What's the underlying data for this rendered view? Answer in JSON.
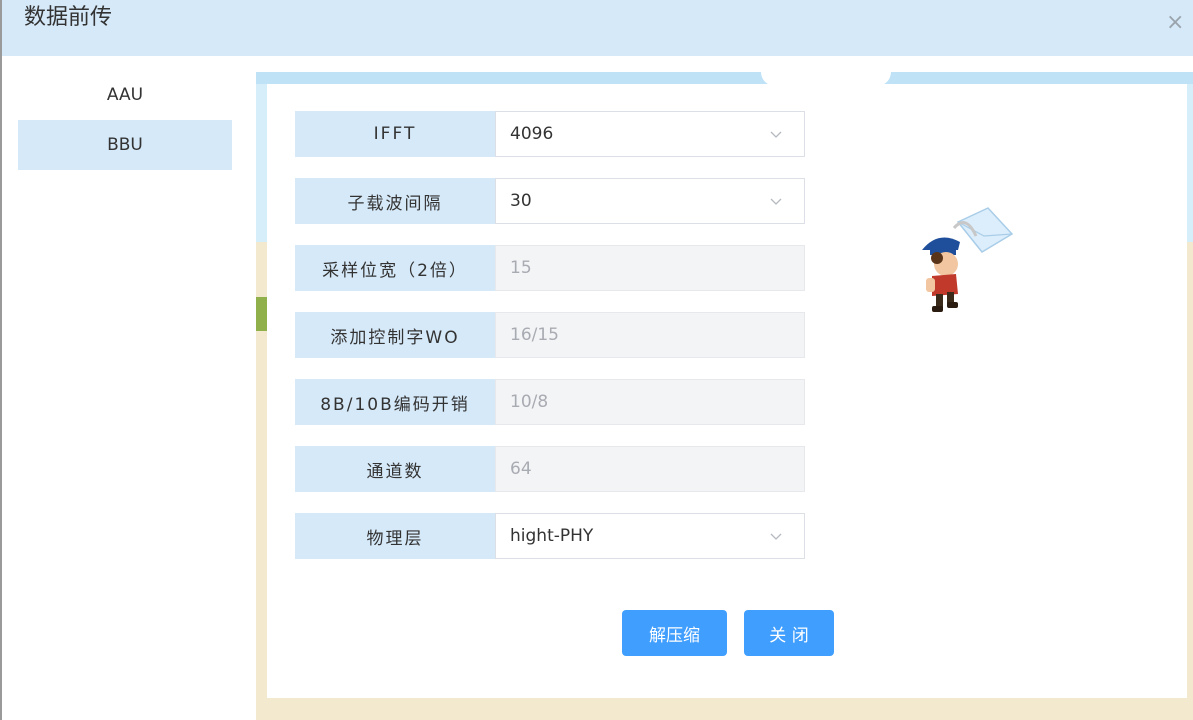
{
  "dialog": {
    "title": "数据前传",
    "close_label": "×"
  },
  "sidebar": {
    "items": [
      {
        "label": "AAU",
        "active": false
      },
      {
        "label": "BBU",
        "active": true
      }
    ]
  },
  "form": {
    "rows": [
      {
        "label": "IFFT",
        "value": "4096",
        "type": "select"
      },
      {
        "label": "子载波间隔",
        "value": "30",
        "type": "select"
      },
      {
        "label": "采样位宽（2倍）",
        "value": "15",
        "type": "readonly"
      },
      {
        "label": "添加控制字WO",
        "value": "16/15",
        "type": "readonly"
      },
      {
        "label": "8B/10B编码开销",
        "value": "10/8",
        "type": "readonly"
      },
      {
        "label": "通道数",
        "value": "64",
        "type": "readonly"
      },
      {
        "label": "物理层",
        "value": "hight-PHY",
        "type": "select"
      }
    ]
  },
  "buttons": {
    "decompress": "解压缩",
    "close": "关 闭"
  },
  "colors": {
    "accent": "#409eff",
    "header_bg": "#d6e9f8",
    "label_bg": "#d6e9f8",
    "readonly_bg": "#f3f4f6"
  },
  "icons": {
    "close": "close-icon",
    "select_arrow": "chevron-down-icon",
    "mascot": "mail-carrier-illustration"
  }
}
